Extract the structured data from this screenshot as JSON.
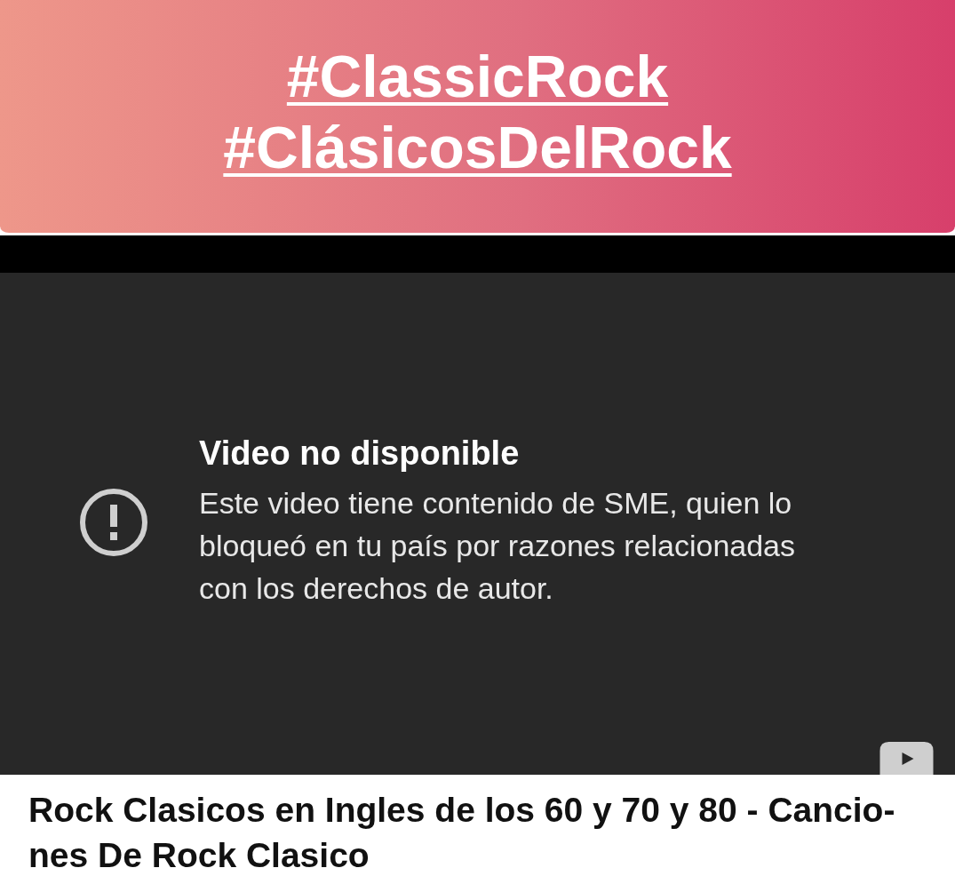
{
  "banner": {
    "hashtags": [
      "#ClassicRock",
      "#ClásicosDelRock"
    ]
  },
  "player": {
    "error_title": "Video no disponible",
    "error_message": "Este video tiene contenido de SME, quien lo bloqueó en tu país por razones relacionadas con los derechos de autor."
  },
  "video_title_lines": [
    "Rock Clasicos en Ingles de los 60 y 70 y 80 - Cancio-",
    "nes De Rock Clasico"
  ]
}
